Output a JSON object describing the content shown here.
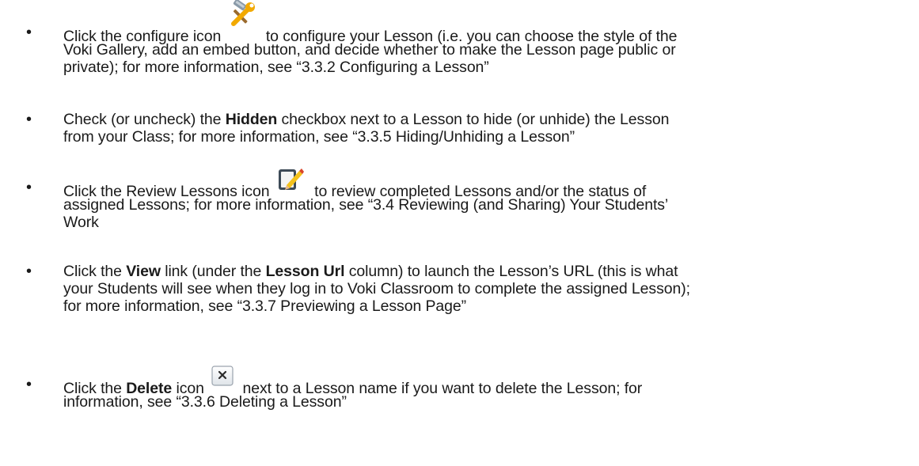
{
  "items": [
    {
      "line1_a": "Click the configure icon",
      "icon": "configure-wrench-hammer-icon",
      "line1_b": "to configure your Lesson (i.e. you can choose the style of the",
      "line2": "Voki Gallery, add an embed button, and decide whether to make the Lesson page public or",
      "line3": "private); for more information, see “3.3.2 Configuring a Lesson”"
    },
    {
      "line1_a": "Check (or uncheck) the",
      "bold1": "Hidden",
      "line1_b": "checkbox next to a Lesson to hide (or unhide) the Lesson",
      "line2": "from your Class; for more information, see “3.3.5 Hiding/Unhiding a Lesson”"
    },
    {
      "line1_a": "Click the Review Lessons icon",
      "icon": "review-lessons-icon",
      "line1_b": "to review completed Lessons and/or the status of",
      "line2": "assigned Lessons; for more information, see “3.4 Reviewing (and Sharing) Your Students’",
      "line3": "Work"
    },
    {
      "line1_a": "Click the",
      "bold1": "View",
      "line1_b": "link (under the",
      "bold2": "Lesson Url",
      "line1_c": "column) to launch the Lesson’s URL (this is what",
      "line2": "your Students will see when they log in to Voki Classroom to complete the assigned Lesson);",
      "line3": "for more information, see “3.3.7 Previewing a Lesson Page”"
    },
    {
      "line1_a": "Click the",
      "bold1": "Delete",
      "line1_b": "icon",
      "icon": "delete-x-icon",
      "line1_c": "next to a Lesson name if you want to delete the Lesson; for",
      "line2": "information, see “3.3.6 Deleting a Lesson”"
    }
  ],
  "bullet_char": "•",
  "colors": {
    "text": "#1a1a1a",
    "wrench_handle": "#f2a900",
    "hammer_head": "#8a9aa8",
    "review_red": "#d9442a",
    "review_yellow": "#f4c21c",
    "delete_border": "#9aa3ad"
  }
}
